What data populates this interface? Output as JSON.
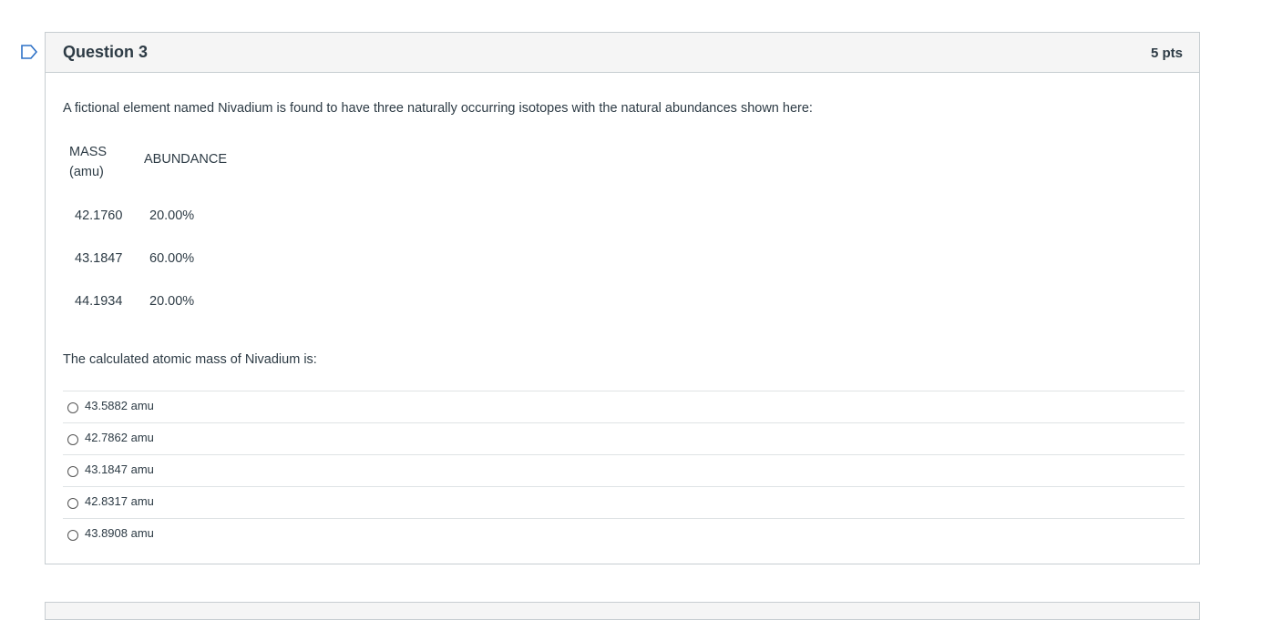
{
  "question": {
    "title": "Question 3",
    "points": "5 pts",
    "intro": "A fictional element named Nivadium is found to have three naturally occurring isotopes with the natural abundances shown here:",
    "table": {
      "headers": {
        "mass_line1": "MASS",
        "mass_line2": "(amu)",
        "abundance": "ABUNDANCE"
      },
      "rows": [
        {
          "mass": "42.1760",
          "abundance": "20.00%"
        },
        {
          "mass": "43.1847",
          "abundance": "60.00%"
        },
        {
          "mass": "44.1934",
          "abundance": "20.00%"
        }
      ]
    },
    "prompt": "The calculated atomic mass of Nivadium is:",
    "answers": [
      {
        "label": "43.5882 amu",
        "selected": false
      },
      {
        "label": "42.7862 amu",
        "selected": false
      },
      {
        "label": "43.1847 amu",
        "selected": false
      },
      {
        "label": "42.8317 amu",
        "selected": false
      },
      {
        "label": "43.8908 amu",
        "selected": false
      }
    ]
  },
  "colors": {
    "flag_outline": "#2d71c7",
    "header_bg": "#f5f5f5",
    "border": "#c7cdd1",
    "text": "#2d3b45"
  },
  "icons": {
    "flag": "bookmark-flag-icon",
    "radio": "radio-button-icon"
  }
}
